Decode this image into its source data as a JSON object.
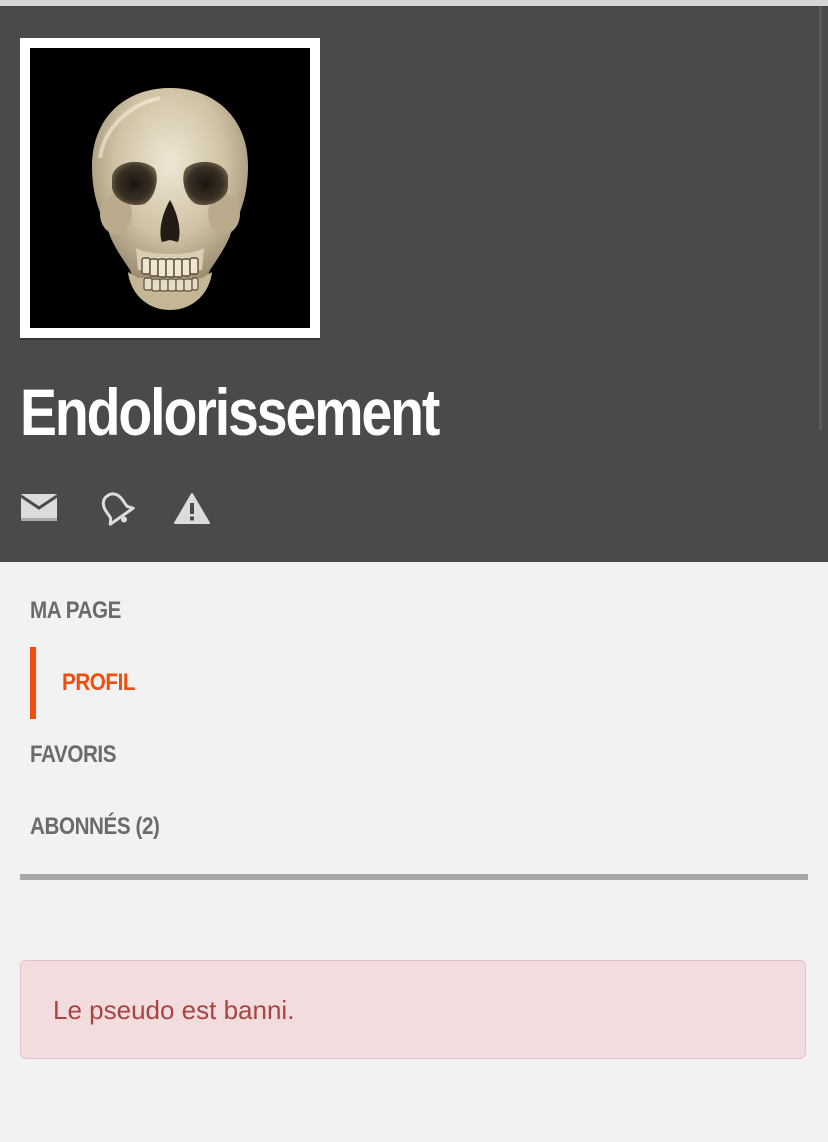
{
  "profile": {
    "username": "Endolorissement",
    "avatar_description": "skull-avatar"
  },
  "actions": [
    {
      "name": "message",
      "icon": "envelope-icon"
    },
    {
      "name": "subscribe",
      "icon": "bell-icon"
    },
    {
      "name": "report",
      "icon": "warning-icon"
    }
  ],
  "nav": {
    "items": [
      {
        "label": "MA PAGE",
        "active": false
      },
      {
        "label": "PROFIL",
        "active": true
      },
      {
        "label": "FAVORIS",
        "active": false
      },
      {
        "label": "ABONNÉS (2)",
        "active": false
      }
    ]
  },
  "alert": {
    "message": "Le pseudo est banni."
  },
  "colors": {
    "header_bg": "#4a4a4a",
    "accent": "#f04e0f",
    "page_bg": "#f2f2f2",
    "alert_bg": "#f2dcde",
    "alert_text": "#a94442"
  }
}
